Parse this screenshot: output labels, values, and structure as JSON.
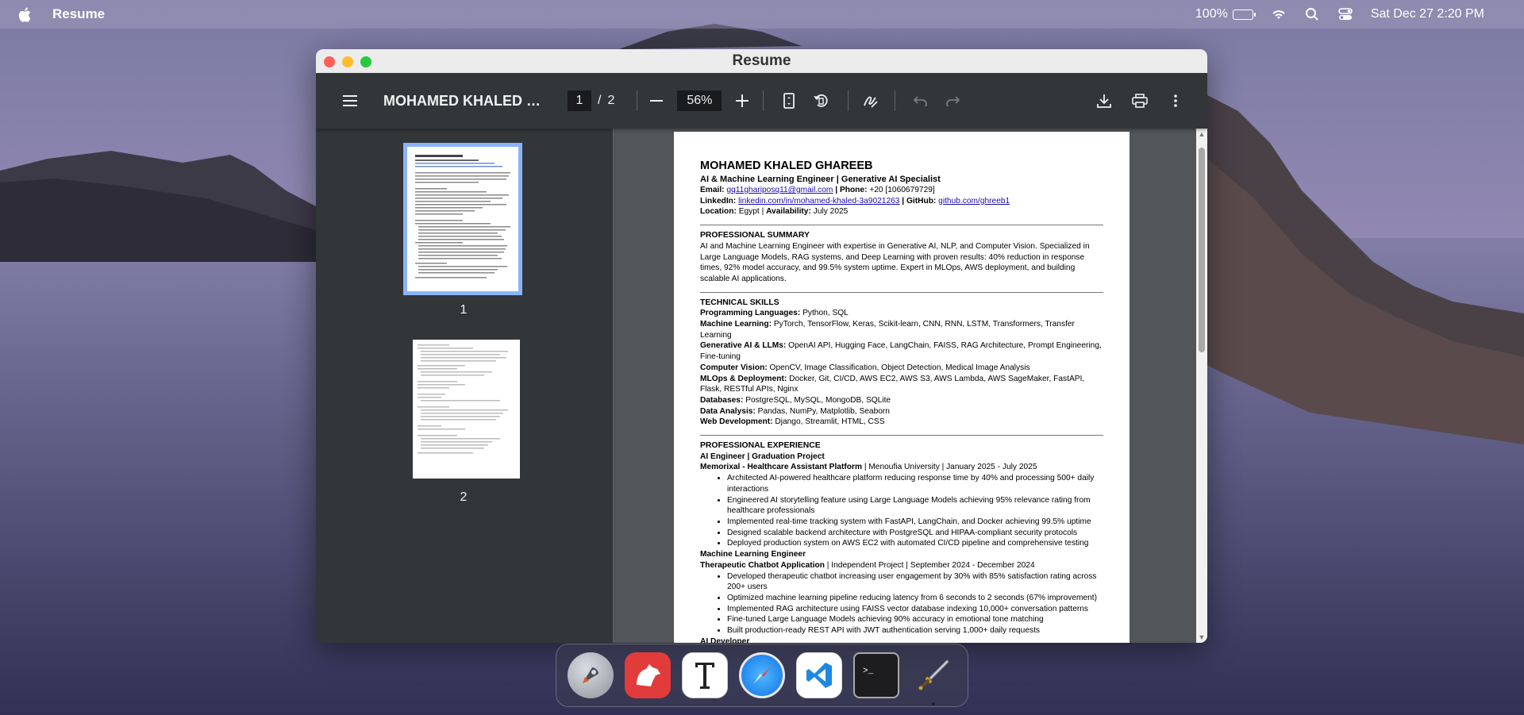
{
  "menubar": {
    "app_name": "Resume",
    "battery": "100%",
    "datetime": "Sat Dec 27  2:20 PM",
    "battery_level": 1.0
  },
  "window": {
    "title": "Resume"
  },
  "toolbar": {
    "doc_title": "MOHAMED KHALED GH...",
    "current_page": "1",
    "separator": "/",
    "total_pages": "2",
    "zoom": "56%"
  },
  "thumbnails": [
    {
      "label": "1"
    },
    {
      "label": "2"
    }
  ],
  "resume": {
    "name": "MOHAMED KHALED GHAREEB",
    "headline": "AI & Machine Learning Engineer | Generative AI Specialist",
    "email_label": "Email:",
    "email": "gq11ghariposq11@gmail.com",
    "phone_label": "| Phone:",
    "phone": "+20 [1060679729]",
    "linkedin_label": "LinkedIn:",
    "linkedin": "linkedin.com/in/mohamed-khaled-3a9021263",
    "github_label": "| GitHub:",
    "github": "github.com/ghreeb1",
    "location_label": "Location:",
    "location": "Egypt |",
    "availability_label": "Availability:",
    "availability": "July 2025",
    "summary_heading": "PROFESSIONAL SUMMARY",
    "summary": "AI and Machine Learning Engineer with expertise in Generative AI, NLP, and Computer Vision. Specialized in Large Language Models, RAG systems, and Deep Learning with proven results: 40% reduction in response times, 92% model accuracy, and 99.5% system uptime. Expert in MLOps, AWS deployment, and building scalable AI applications.",
    "skills_heading": "TECHNICAL SKILLS",
    "skills": [
      {
        "label": "Programming Languages:",
        "value": "Python, SQL"
      },
      {
        "label": "Machine Learning:",
        "value": "PyTorch, TensorFlow, Keras, Scikit-learn, CNN, RNN, LSTM, Transformers, Transfer Learning"
      },
      {
        "label": "Generative AI & LLMs:",
        "value": "OpenAI API, Hugging Face, LangChain, FAISS, RAG Architecture, Prompt Engineering, Fine-tuning"
      },
      {
        "label": "Computer Vision:",
        "value": "OpenCV, Image Classification, Object Detection, Medical Image Analysis"
      },
      {
        "label": "MLOps & Deployment:",
        "value": "Docker, Git, CI/CD, AWS EC2, AWS S3, AWS Lambda, AWS SageMaker, FastAPI, Flask, RESTful APIs, Nginx"
      },
      {
        "label": "Databases:",
        "value": "PostgreSQL, MySQL, MongoDB, SQLite"
      },
      {
        "label": "Data Analysis:",
        "value": "Pandas, NumPy, Matplotlib, Seaborn"
      },
      {
        "label": "Web Development:",
        "value": "Django, Streamlit, HTML, CSS"
      }
    ],
    "experience_heading": "PROFESSIONAL EXPERIENCE",
    "jobs": [
      {
        "role": "AI Engineer | Graduation Project",
        "project": "Memorixal - Healthcare Assistant Platform",
        "meta": "| Menoufia University | January 2025 - July 2025",
        "bullets": [
          "Architected AI-powered healthcare platform reducing response time by 40% and processing 500+ daily interactions",
          "Engineered AI storytelling feature using Large Language Models achieving 95% relevance rating from healthcare professionals",
          "Implemented real-time tracking system with FastAPI, LangChain, and Docker achieving 99.5% uptime",
          "Designed scalable backend architecture with PostgreSQL and HIPAA-compliant security protocols",
          "Deployed production system on AWS EC2 with automated CI/CD pipeline and comprehensive testing"
        ]
      },
      {
        "role": "Machine Learning Engineer",
        "project": "Therapeutic Chatbot Application",
        "meta": "| Independent Project | September 2024 - December 2024",
        "bullets": [
          "Developed therapeutic chatbot increasing user engagement by 30% with 85% satisfaction rating across 200+ users",
          "Optimized machine learning pipeline reducing latency from 6 seconds to 2 seconds (67% improvement)",
          "Implemented RAG architecture using FAISS vector database indexing 10,000+ conversation patterns",
          "Fine-tuned Large Language Models achieving 90% accuracy in emotional tone matching",
          "Built production-ready REST API with JWT authentication serving 1,000+ daily requests"
        ]
      }
    ],
    "last_role": "AI Developer"
  },
  "dock": {
    "items": [
      "launchpad-icon",
      "bear-icon",
      "typora-icon",
      "safari-icon",
      "vscode-icon",
      "terminal-icon",
      "sword-icon"
    ]
  }
}
